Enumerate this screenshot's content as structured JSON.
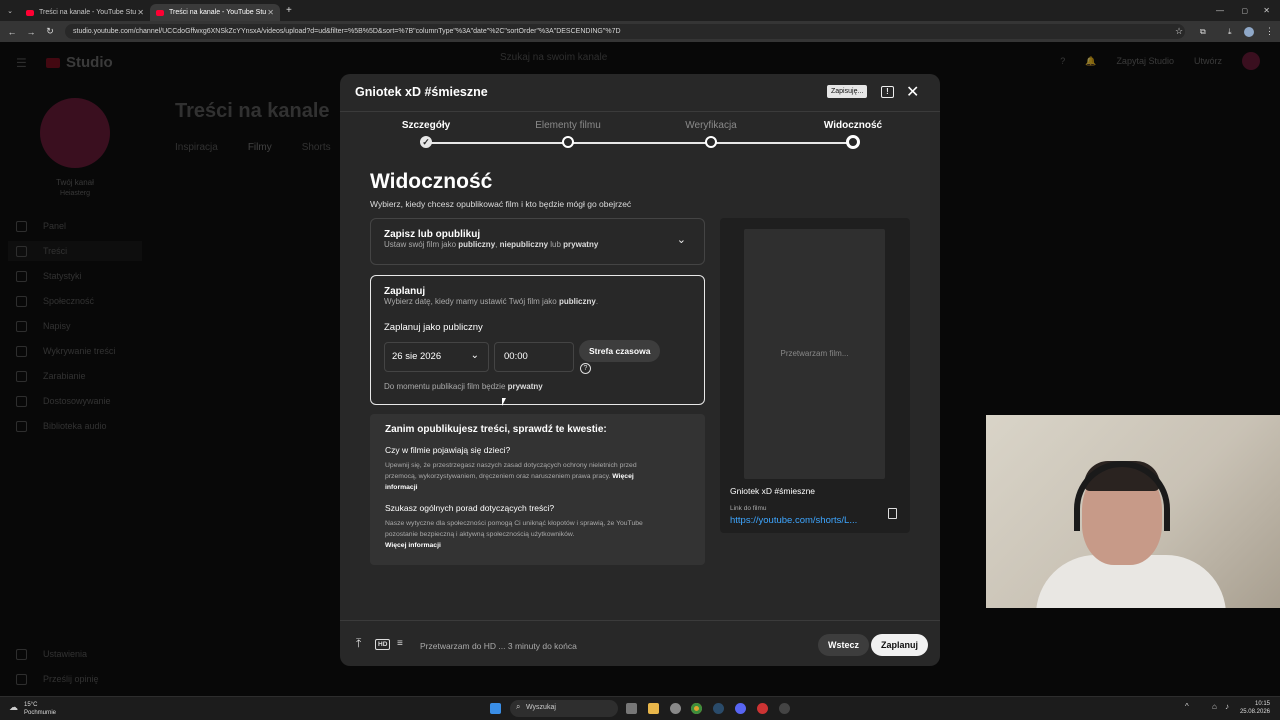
{
  "browser": {
    "tabs": [
      {
        "title": "Treści na kanale - YouTube Stu"
      },
      {
        "title": "Treści na kanale - YouTube Stu"
      }
    ],
    "url": "studio.youtube.com/channel/UCCdoGffwxg6XNSkZcYYnsxA/videos/upload?d=ud&filter=%5B%5D&sort=%7B\"columnType\"%3A\"date\"%2C\"sortOrder\"%3A\"DESCENDING\"%7D"
  },
  "studio": {
    "logo": "Studio",
    "search_placeholder": "Szukaj na swoim kanale",
    "create_label": "Zapytaj Studio",
    "upload_label": "Utwórz",
    "channel_label": "Twój kanał",
    "channel_name": "Heiasterg",
    "page_title": "Treści na kanale",
    "content_tabs": [
      "Inspiracja",
      "Filmy",
      "Shorts"
    ],
    "nav": [
      "Panel",
      "Treści",
      "Statystyki",
      "Społeczność",
      "Napisy",
      "Wykrywanie treści",
      "Zarabianie",
      "Dostosowywanie",
      "Biblioteka audio"
    ],
    "nav_bottom": [
      "Ustawienia",
      "Prześlij opinię"
    ]
  },
  "modal": {
    "title": "Gniotek xD #śmieszne",
    "saving": "Zapisuję...",
    "steps": [
      "Szczegóły",
      "Elementy filmu",
      "Weryfikacja",
      "Widoczność"
    ],
    "heading": "Widoczność",
    "subheading": "Wybierz, kiedy chcesz opublikować film i kto będzie mógł go obejrzeć",
    "save_publish": {
      "title": "Zapisz lub opublikuj",
      "desc_a": "Ustaw swój film jako ",
      "public": "publiczny",
      "sep1": ", ",
      "unlisted": "niepubliczny",
      "sep2": " lub ",
      "private": "prywatny"
    },
    "schedule": {
      "title": "Zaplanuj",
      "desc_a": "Wybierz datę, kiedy mamy ustawić Twój film jako ",
      "public": "publiczny",
      "desc_end": ".",
      "label": "Zaplanuj jako publiczny",
      "date": "26 sie 2026",
      "time": "00:00",
      "timezone": "Strefa czasowa",
      "note_a": "Do momentu publikacji film będzie ",
      "note_b": "prywatny"
    },
    "checks": {
      "title": "Zanim opublikujesz treści, sprawdź te kwestie:",
      "q1": "Czy w filmie pojawiają się dzieci?",
      "p1": "Upewnij się, że przestrzegasz naszych zasad dotyczących ochrony nieletnich przed przemocą, wykorzystywaniem, dręczeniem oraz naruszeniem prawa pracy. ",
      "more1": "Więcej informacji",
      "q2": "Szukasz ogólnych porad dotyczących treści?",
      "p2": "Nasze wytyczne dla społeczności pomogą Ci uniknąć kłopotów i sprawią, że YouTube pozostanie bezpieczną i aktywną społecznością użytkowników.",
      "more2": "Więcej informacji"
    },
    "preview": {
      "processing": "Przetwarzam film...",
      "video_title": "Gniotek xD #śmieszne",
      "link_label": "Link do filmu",
      "link": "https://youtube.com/shorts/L..."
    },
    "footer": {
      "hd": "HD",
      "status": "Przetwarzam do HD ... 3 minuty do końca",
      "back": "Wstecz",
      "schedule": "Zaplanuj"
    }
  },
  "taskbar": {
    "temp": "15°C",
    "weather": "Pochmurnie",
    "search": "Wyszukaj",
    "time": "10:15",
    "date": "25.08.2026"
  }
}
